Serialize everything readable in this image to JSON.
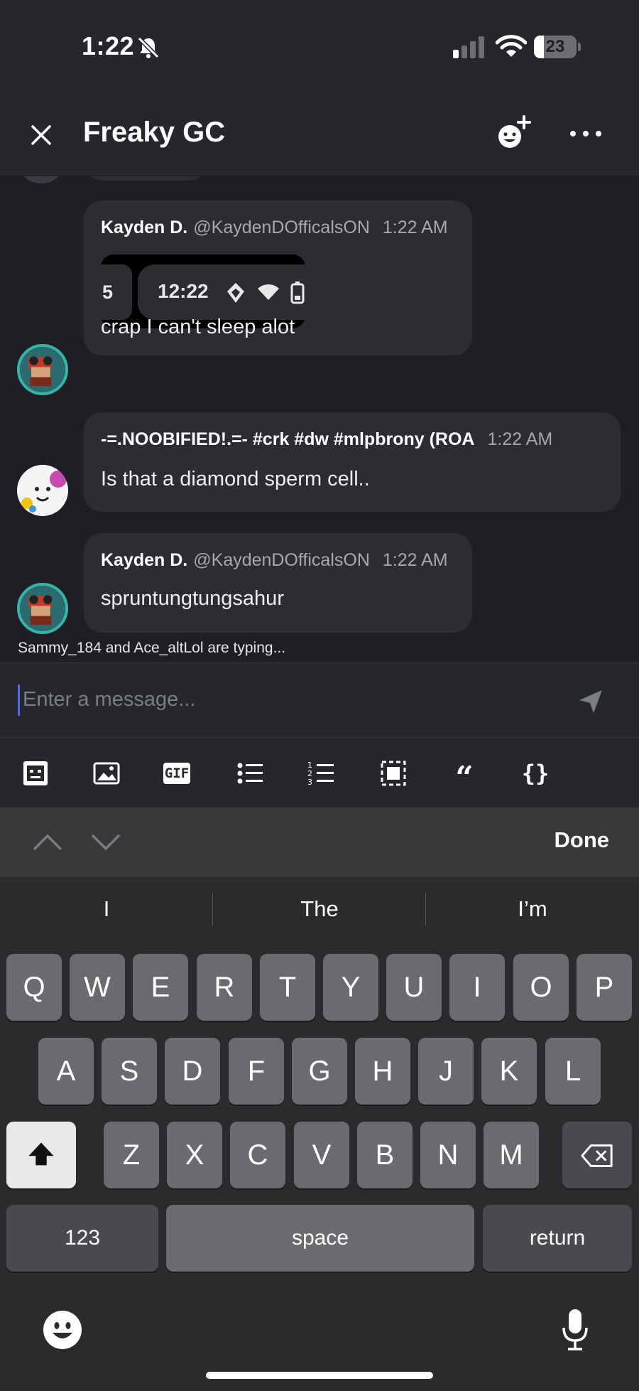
{
  "status_bar": {
    "time": "1:22",
    "battery": "23",
    "battery_level": 0.23
  },
  "header": {
    "title": "Freaky GC"
  },
  "messages": [
    {
      "author": "Kayden D.",
      "handle": "@KaydenDOfficalsON",
      "time": "1:22 AM",
      "attachment": {
        "left_text": "5",
        "time": "12:22"
      },
      "text": "crap I can't sleep alot"
    },
    {
      "author": "-=.NOOBIFIED!.=- #crk #dw #mlpbrony (ROA",
      "time": "1:22 AM",
      "text": "Is that a diamond sperm cell.."
    },
    {
      "author": "Kayden D.",
      "handle": "@KaydenDOfficalsON",
      "time": "1:22 AM",
      "text": "spruntungtungsahur"
    }
  ],
  "typing_indicator": "Sammy_184 and Ace_altLol are typing...",
  "composer": {
    "placeholder": "Enter a message..."
  },
  "toolbar": {
    "gif_label": "GIF",
    "quote_label": "“",
    "code_label": "{}"
  },
  "keyboard": {
    "done_label": "Done",
    "suggestions": [
      "I",
      "The",
      "I’m"
    ],
    "row1": [
      "Q",
      "W",
      "E",
      "R",
      "T",
      "Y",
      "U",
      "I",
      "O",
      "P"
    ],
    "row2": [
      "A",
      "S",
      "D",
      "F",
      "G",
      "H",
      "J",
      "K",
      "L"
    ],
    "row3": [
      "Z",
      "X",
      "C",
      "V",
      "B",
      "N",
      "M"
    ],
    "numbers_label": "123",
    "space_label": "space",
    "return_label": "return"
  },
  "icons": [
    "bell-slash-icon",
    "signal-icon",
    "wifi-icon",
    "close-icon",
    "add-member-icon",
    "more-icon",
    "send-icon",
    "sticker-icon",
    "image-icon",
    "gif-icon",
    "bullet-list-icon",
    "numbered-list-icon",
    "spoiler-icon",
    "quote-icon",
    "code-icon",
    "chevron-up-icon",
    "chevron-down-icon",
    "shift-icon",
    "backspace-icon",
    "emoji-icon",
    "microphone-icon"
  ],
  "colors": {
    "background": "#1e1f24",
    "bubble": "#2c2d33",
    "accent": "#5865f2",
    "avatar_ring": "#35b3a3"
  }
}
